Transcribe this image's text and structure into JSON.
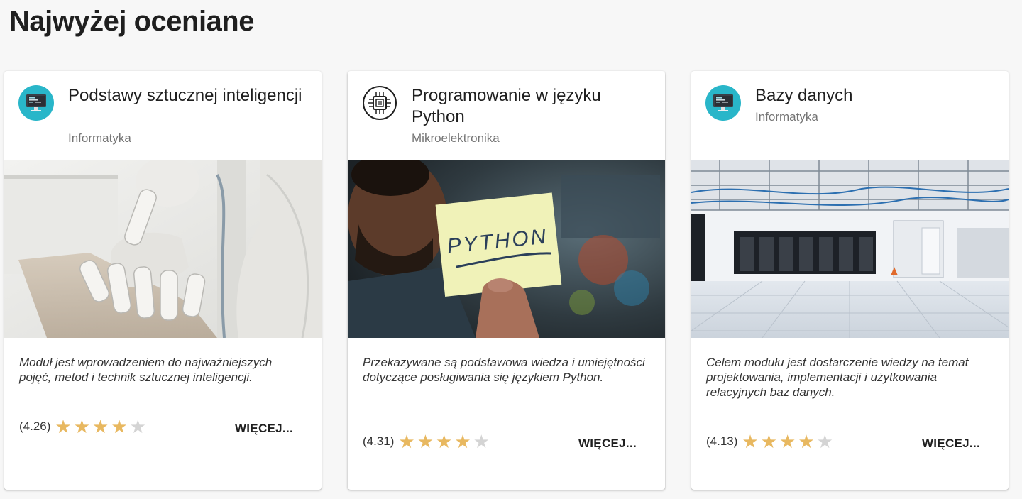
{
  "page": {
    "title": "Najwyżej oceniane"
  },
  "colors": {
    "star_on": "#e8b860",
    "star_off": "#d4d4d4",
    "avatar_teal": "#29b6c9"
  },
  "cards": [
    {
      "title": "Podstawy sztucznej inteligencji",
      "category": "Informatyka",
      "avatar_icon": "monitor-icon",
      "image": "robot-hand-photo",
      "description": "Moduł jest wprowadzeniem do najważniejszych pojęć, metod i technik sztucznej inteligencji.",
      "rating_text": "(4.26)",
      "rating": 4.26,
      "stars_filled": 4,
      "stars_total": 5,
      "more_label": "WIĘCEJ..."
    },
    {
      "title": "Programowanie w języku Python",
      "category": "Mikroelektronika",
      "avatar_icon": "chip-icon",
      "image": "python-note-photo",
      "image_text": "PYTHON",
      "description": "Przekazywane są podstawowa wiedza i umiejętności dotyczące posługiwania się językiem Python.",
      "rating_text": "(4.31)",
      "rating": 4.31,
      "stars_filled": 4,
      "stars_total": 5,
      "more_label": "WIĘCEJ..."
    },
    {
      "title": "Bazy danych",
      "category": "Informatyka",
      "avatar_icon": "monitor-icon",
      "image": "server-room-photo",
      "description": "Celem modułu jest dostarczenie wiedzy na temat projektowania, implementacji i użytkowania relacyjnych baz danych.",
      "rating_text": "(4.13)",
      "rating": 4.13,
      "stars_filled": 4,
      "stars_total": 5,
      "more_label": "WIĘCEJ..."
    }
  ]
}
